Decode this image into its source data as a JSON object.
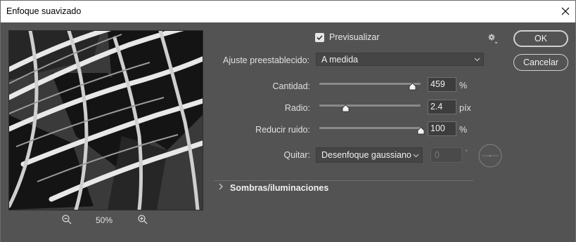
{
  "window": {
    "title": "Enfoque suavizado"
  },
  "preview": {
    "zoom_level": "50%"
  },
  "options": {
    "preview_label": "Previsualizar",
    "preview_checked": true
  },
  "buttons": {
    "ok": "OK",
    "cancel": "Cancelar"
  },
  "preset": {
    "label": "Ajuste preestablecido:",
    "value": "A medida"
  },
  "amount": {
    "label": "Cantidad:",
    "value": "459",
    "unit": "%",
    "slider_fraction": 0.92
  },
  "radius": {
    "label": "Radio:",
    "value": "2.4",
    "unit": "píx",
    "slider_fraction": 0.26
  },
  "noise": {
    "label": "Reducir ruido:",
    "value": "100",
    "unit": "%",
    "slider_fraction": 1.0
  },
  "remove": {
    "label": "Quitar:",
    "value": "Desenfoque gaussiano",
    "angle": "0",
    "angle_unit": "°"
  },
  "section": {
    "label": "Sombras/iluminaciones"
  },
  "icons": [
    "close-icon",
    "zoom-out-icon",
    "zoom-in-icon",
    "gear-icon",
    "checkmark-icon",
    "chevron-down-icon",
    "chevron-right-icon",
    "angle-dial-icon",
    "slider-thumb-icon"
  ]
}
